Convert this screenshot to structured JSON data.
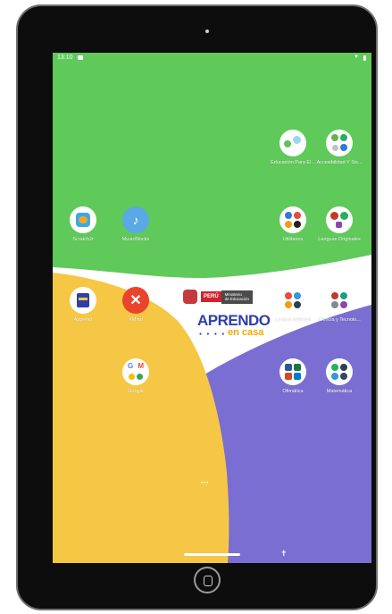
{
  "status": {
    "time": "13:10",
    "notif_icon": "image-notification-icon",
    "wifi_icon": "wifi-icon",
    "battery_icon": "battery-icon"
  },
  "colors": {
    "bg_green": "#5fc95a",
    "bg_yellow": "#f6c744",
    "bg_purple": "#7a6ed3",
    "bg_white": "#ffffff",
    "brand_blue": "#2f3ea8",
    "brand_orange": "#f6a800"
  },
  "apps": [
    {
      "id": "educacion",
      "label": "Educación Para El...",
      "icon": "folder-icon"
    },
    {
      "id": "accesibilidad",
      "label": "Accesibilidad Y Sis...",
      "icon": "folder-icon"
    },
    {
      "id": "scratchjr",
      "label": "ScratchJr",
      "icon": "scratch-cat-icon"
    },
    {
      "id": "musicblocks",
      "label": "MusicBlocks",
      "icon": "music-notes-icon"
    },
    {
      "id": "utilitarios",
      "label": "Utilitarios",
      "icon": "folder-icon"
    },
    {
      "id": "lenguas",
      "label": "Lenguas Originales",
      "icon": "folder-icon"
    },
    {
      "id": "apprend",
      "label": "Apprend",
      "icon": "book-icon"
    },
    {
      "id": "xmind",
      "label": "XMind",
      "icon": "xmind-icon"
    },
    {
      "id": "lenguas_materna",
      "label": "Lengua Materna",
      "icon": "folder-icon"
    },
    {
      "id": "ciencia",
      "label": "Ciencia y Tecnolo...",
      "icon": "folder-icon"
    },
    {
      "id": "google",
      "label": "Google",
      "icon": "folder-icon"
    },
    {
      "id": "ofimatica",
      "label": "Ofimática",
      "icon": "folder-icon"
    },
    {
      "id": "matematica",
      "label": "Matemática",
      "icon": "folder-icon"
    }
  ],
  "logo": {
    "peru": "PERÚ",
    "ministerio_line1": "Ministerio",
    "ministerio_line2": "de Educación",
    "aprendo": "APRENDO",
    "en_casa": "en casa"
  },
  "pager": {
    "dots": "•••",
    "current_page": 2,
    "page_count": 3
  },
  "nav": {
    "home_pill": "home-gesture-pill",
    "accessibility": "accessibility-icon"
  }
}
